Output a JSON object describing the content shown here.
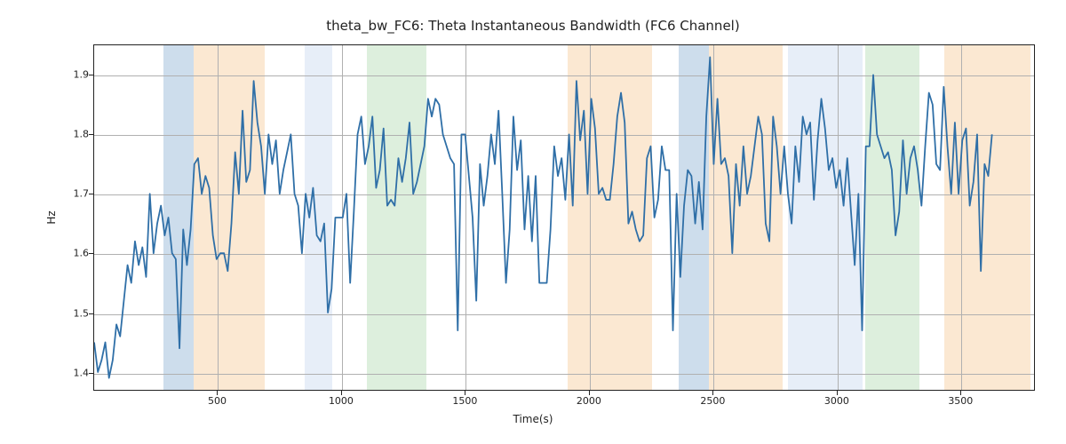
{
  "chart_data": {
    "type": "line",
    "title": "theta_bw_FC6: Theta Instantaneous Bandwidth (FC6 Channel)",
    "xlabel": "Time(s)",
    "ylabel": "Hz",
    "xlim": [
      0,
      3800
    ],
    "ylim": [
      1.37,
      1.95
    ],
    "xticks": [
      500,
      1000,
      1500,
      2000,
      2500,
      3000,
      3500
    ],
    "yticks": [
      1.4,
      1.5,
      1.6,
      1.7,
      1.8,
      1.9
    ],
    "series": [
      {
        "name": "theta_bw_FC6",
        "color": "#2f6fa7",
        "x": [
          0,
          15,
          30,
          45,
          60,
          75,
          90,
          105,
          120,
          135,
          150,
          165,
          180,
          195,
          210,
          225,
          240,
          255,
          270,
          285,
          300,
          315,
          330,
          345,
          360,
          375,
          390,
          405,
          420,
          435,
          450,
          465,
          480,
          495,
          510,
          525,
          540,
          555,
          570,
          585,
          600,
          615,
          630,
          645,
          660,
          675,
          690,
          705,
          720,
          735,
          750,
          765,
          780,
          795,
          810,
          825,
          840,
          855,
          870,
          885,
          900,
          915,
          930,
          945,
          960,
          975,
          990,
          1005,
          1020,
          1035,
          1050,
          1065,
          1080,
          1095,
          1110,
          1125,
          1140,
          1155,
          1170,
          1185,
          1200,
          1215,
          1230,
          1245,
          1260,
          1275,
          1290,
          1305,
          1320,
          1335,
          1350,
          1365,
          1380,
          1395,
          1410,
          1425,
          1440,
          1455,
          1470,
          1485,
          1500,
          1515,
          1530,
          1545,
          1560,
          1575,
          1590,
          1605,
          1620,
          1635,
          1650,
          1665,
          1680,
          1695,
          1710,
          1725,
          1740,
          1755,
          1770,
          1785,
          1800,
          1815,
          1830,
          1845,
          1860,
          1875,
          1890,
          1905,
          1920,
          1935,
          1950,
          1965,
          1980,
          1995,
          2010,
          2025,
          2040,
          2055,
          2070,
          2085,
          2100,
          2115,
          2130,
          2145,
          2160,
          2175,
          2190,
          2205,
          2220,
          2235,
          2250,
          2265,
          2280,
          2295,
          2310,
          2325,
          2340,
          2355,
          2370,
          2385,
          2400,
          2415,
          2430,
          2445,
          2460,
          2475,
          2490,
          2505,
          2520,
          2535,
          2550,
          2565,
          2580,
          2595,
          2610,
          2625,
          2640,
          2655,
          2670,
          2685,
          2700,
          2715,
          2730,
          2745,
          2760,
          2775,
          2790,
          2805,
          2820,
          2835,
          2850,
          2865,
          2880,
          2895,
          2910,
          2925,
          2940,
          2955,
          2970,
          2985,
          3000,
          3015,
          3030,
          3045,
          3060,
          3075,
          3090,
          3105,
          3120,
          3135,
          3150,
          3165,
          3180,
          3195,
          3210,
          3225,
          3240,
          3255,
          3270,
          3285,
          3300,
          3315,
          3330,
          3345,
          3360,
          3375,
          3390,
          3405,
          3420,
          3435,
          3450,
          3465,
          3480,
          3495,
          3510,
          3525,
          3540,
          3555,
          3570,
          3585,
          3600,
          3615,
          3630,
          3645,
          3660,
          3675,
          3690,
          3705,
          3720,
          3735,
          3750,
          3765,
          3780
        ],
        "y": [
          1.45,
          1.4,
          1.42,
          1.45,
          1.39,
          1.42,
          1.48,
          1.46,
          1.52,
          1.58,
          1.55,
          1.62,
          1.58,
          1.61,
          1.56,
          1.7,
          1.6,
          1.65,
          1.68,
          1.63,
          1.66,
          1.6,
          1.59,
          1.44,
          1.64,
          1.58,
          1.64,
          1.75,
          1.76,
          1.7,
          1.73,
          1.71,
          1.63,
          1.59,
          1.6,
          1.6,
          1.57,
          1.65,
          1.77,
          1.7,
          1.84,
          1.72,
          1.74,
          1.89,
          1.82,
          1.78,
          1.7,
          1.8,
          1.75,
          1.79,
          1.7,
          1.74,
          1.77,
          1.8,
          1.7,
          1.68,
          1.6,
          1.7,
          1.66,
          1.71,
          1.63,
          1.62,
          1.65,
          1.5,
          1.54,
          1.66,
          1.66,
          1.66,
          1.7,
          1.55,
          1.67,
          1.8,
          1.83,
          1.75,
          1.78,
          1.83,
          1.71,
          1.74,
          1.81,
          1.68,
          1.69,
          1.68,
          1.76,
          1.72,
          1.76,
          1.82,
          1.7,
          1.72,
          1.75,
          1.78,
          1.86,
          1.83,
          1.86,
          1.85,
          1.8,
          1.78,
          1.76,
          1.75,
          1.47,
          1.8,
          1.8,
          1.73,
          1.66,
          1.52,
          1.75,
          1.68,
          1.73,
          1.8,
          1.75,
          1.84,
          1.7,
          1.55,
          1.64,
          1.83,
          1.74,
          1.79,
          1.64,
          1.73,
          1.62,
          1.73,
          1.55,
          1.55,
          1.55,
          1.64,
          1.78,
          1.73,
          1.76,
          1.69,
          1.8,
          1.68,
          1.89,
          1.79,
          1.84,
          1.7,
          1.86,
          1.81,
          1.7,
          1.71,
          1.69,
          1.69,
          1.75,
          1.83,
          1.87,
          1.82,
          1.65,
          1.67,
          1.64,
          1.62,
          1.63,
          1.76,
          1.78,
          1.66,
          1.69,
          1.78,
          1.74,
          1.74,
          1.47,
          1.7,
          1.56,
          1.68,
          1.74,
          1.73,
          1.65,
          1.72,
          1.64,
          1.83,
          1.93,
          1.75,
          1.86,
          1.75,
          1.76,
          1.73,
          1.6,
          1.75,
          1.68,
          1.78,
          1.7,
          1.73,
          1.78,
          1.83,
          1.8,
          1.65,
          1.62,
          1.83,
          1.78,
          1.7,
          1.78,
          1.7,
          1.65,
          1.78,
          1.72,
          1.83,
          1.8,
          1.82,
          1.69,
          1.79,
          1.86,
          1.81,
          1.74,
          1.76,
          1.71,
          1.74,
          1.68,
          1.76,
          1.67,
          1.58,
          1.7,
          1.47,
          1.78,
          1.78,
          1.9,
          1.8,
          1.78,
          1.76,
          1.77,
          1.74,
          1.63,
          1.67,
          1.79,
          1.7,
          1.76,
          1.78,
          1.74,
          1.68,
          1.78,
          1.87,
          1.85,
          1.75,
          1.74,
          1.88,
          1.78,
          1.7,
          1.82,
          1.7,
          1.79,
          1.81,
          1.68,
          1.72,
          1.8,
          1.57,
          1.75,
          1.73,
          1.8
        ]
      }
    ],
    "bands": [
      {
        "x0": 280,
        "x1": 400,
        "color": "blue1"
      },
      {
        "x0": 400,
        "x1": 690,
        "color": "orange1"
      },
      {
        "x0": 850,
        "x1": 960,
        "color": "blue2"
      },
      {
        "x0": 1100,
        "x1": 1340,
        "color": "green1"
      },
      {
        "x0": 1910,
        "x1": 2250,
        "color": "orange2"
      },
      {
        "x0": 2360,
        "x1": 2480,
        "color": "blue1"
      },
      {
        "x0": 2480,
        "x1": 2780,
        "color": "orange1"
      },
      {
        "x0": 2800,
        "x1": 3100,
        "color": "blue2"
      },
      {
        "x0": 3110,
        "x1": 3330,
        "color": "green1"
      },
      {
        "x0": 3430,
        "x1": 3780,
        "color": "orange1"
      }
    ]
  }
}
